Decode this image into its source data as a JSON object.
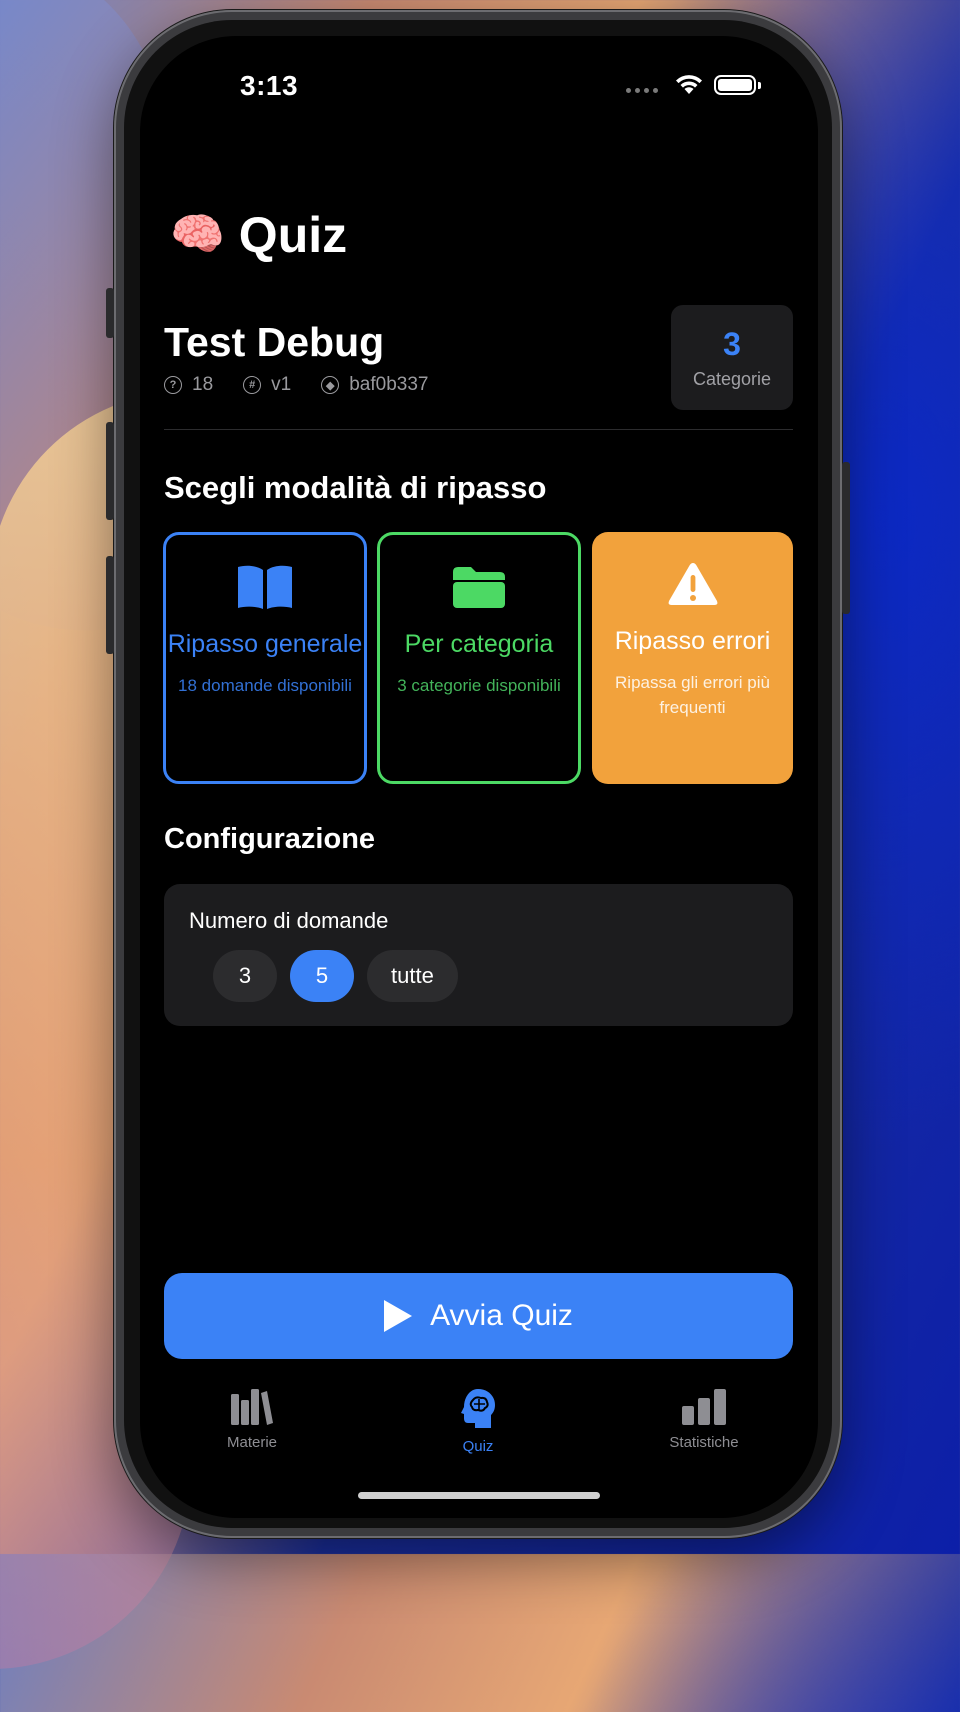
{
  "status": {
    "time": "3:13"
  },
  "header": {
    "emoji": "🧠",
    "title": "Quiz"
  },
  "quiz": {
    "name": "Test Debug",
    "questions": "18",
    "version": "v1",
    "hash": "baf0b337",
    "categories_count": "3",
    "categories_label": "Categorie"
  },
  "modes": {
    "heading": "Scegli modalità di ripasso",
    "general": {
      "title": "Ripasso generale",
      "subtitle": "18 domande disponibili",
      "icon": "book-icon"
    },
    "category": {
      "title": "Per categoria",
      "subtitle": "3 categorie disponibili",
      "icon": "folder-icon"
    },
    "errors": {
      "title": "Ripasso errori",
      "subtitle": "Ripassa gli errori più frequenti",
      "icon": "warning-icon"
    }
  },
  "config": {
    "heading": "Configurazione",
    "count_label": "Numero di domande",
    "options": [
      "3",
      "5",
      "tutte"
    ],
    "selected": "5"
  },
  "start_button": {
    "label": "Avvia Quiz"
  },
  "tabbar": {
    "items": [
      {
        "label": "Materie",
        "icon": "books-icon",
        "active": false
      },
      {
        "label": "Quiz",
        "icon": "brain-head-icon",
        "active": true
      },
      {
        "label": "Statistiche",
        "icon": "chart-bar-icon",
        "active": false
      }
    ]
  },
  "colors": {
    "accent": "#3b82f6",
    "green": "#4cd964",
    "orange": "#f2a23c",
    "card": "#1c1c1e"
  }
}
